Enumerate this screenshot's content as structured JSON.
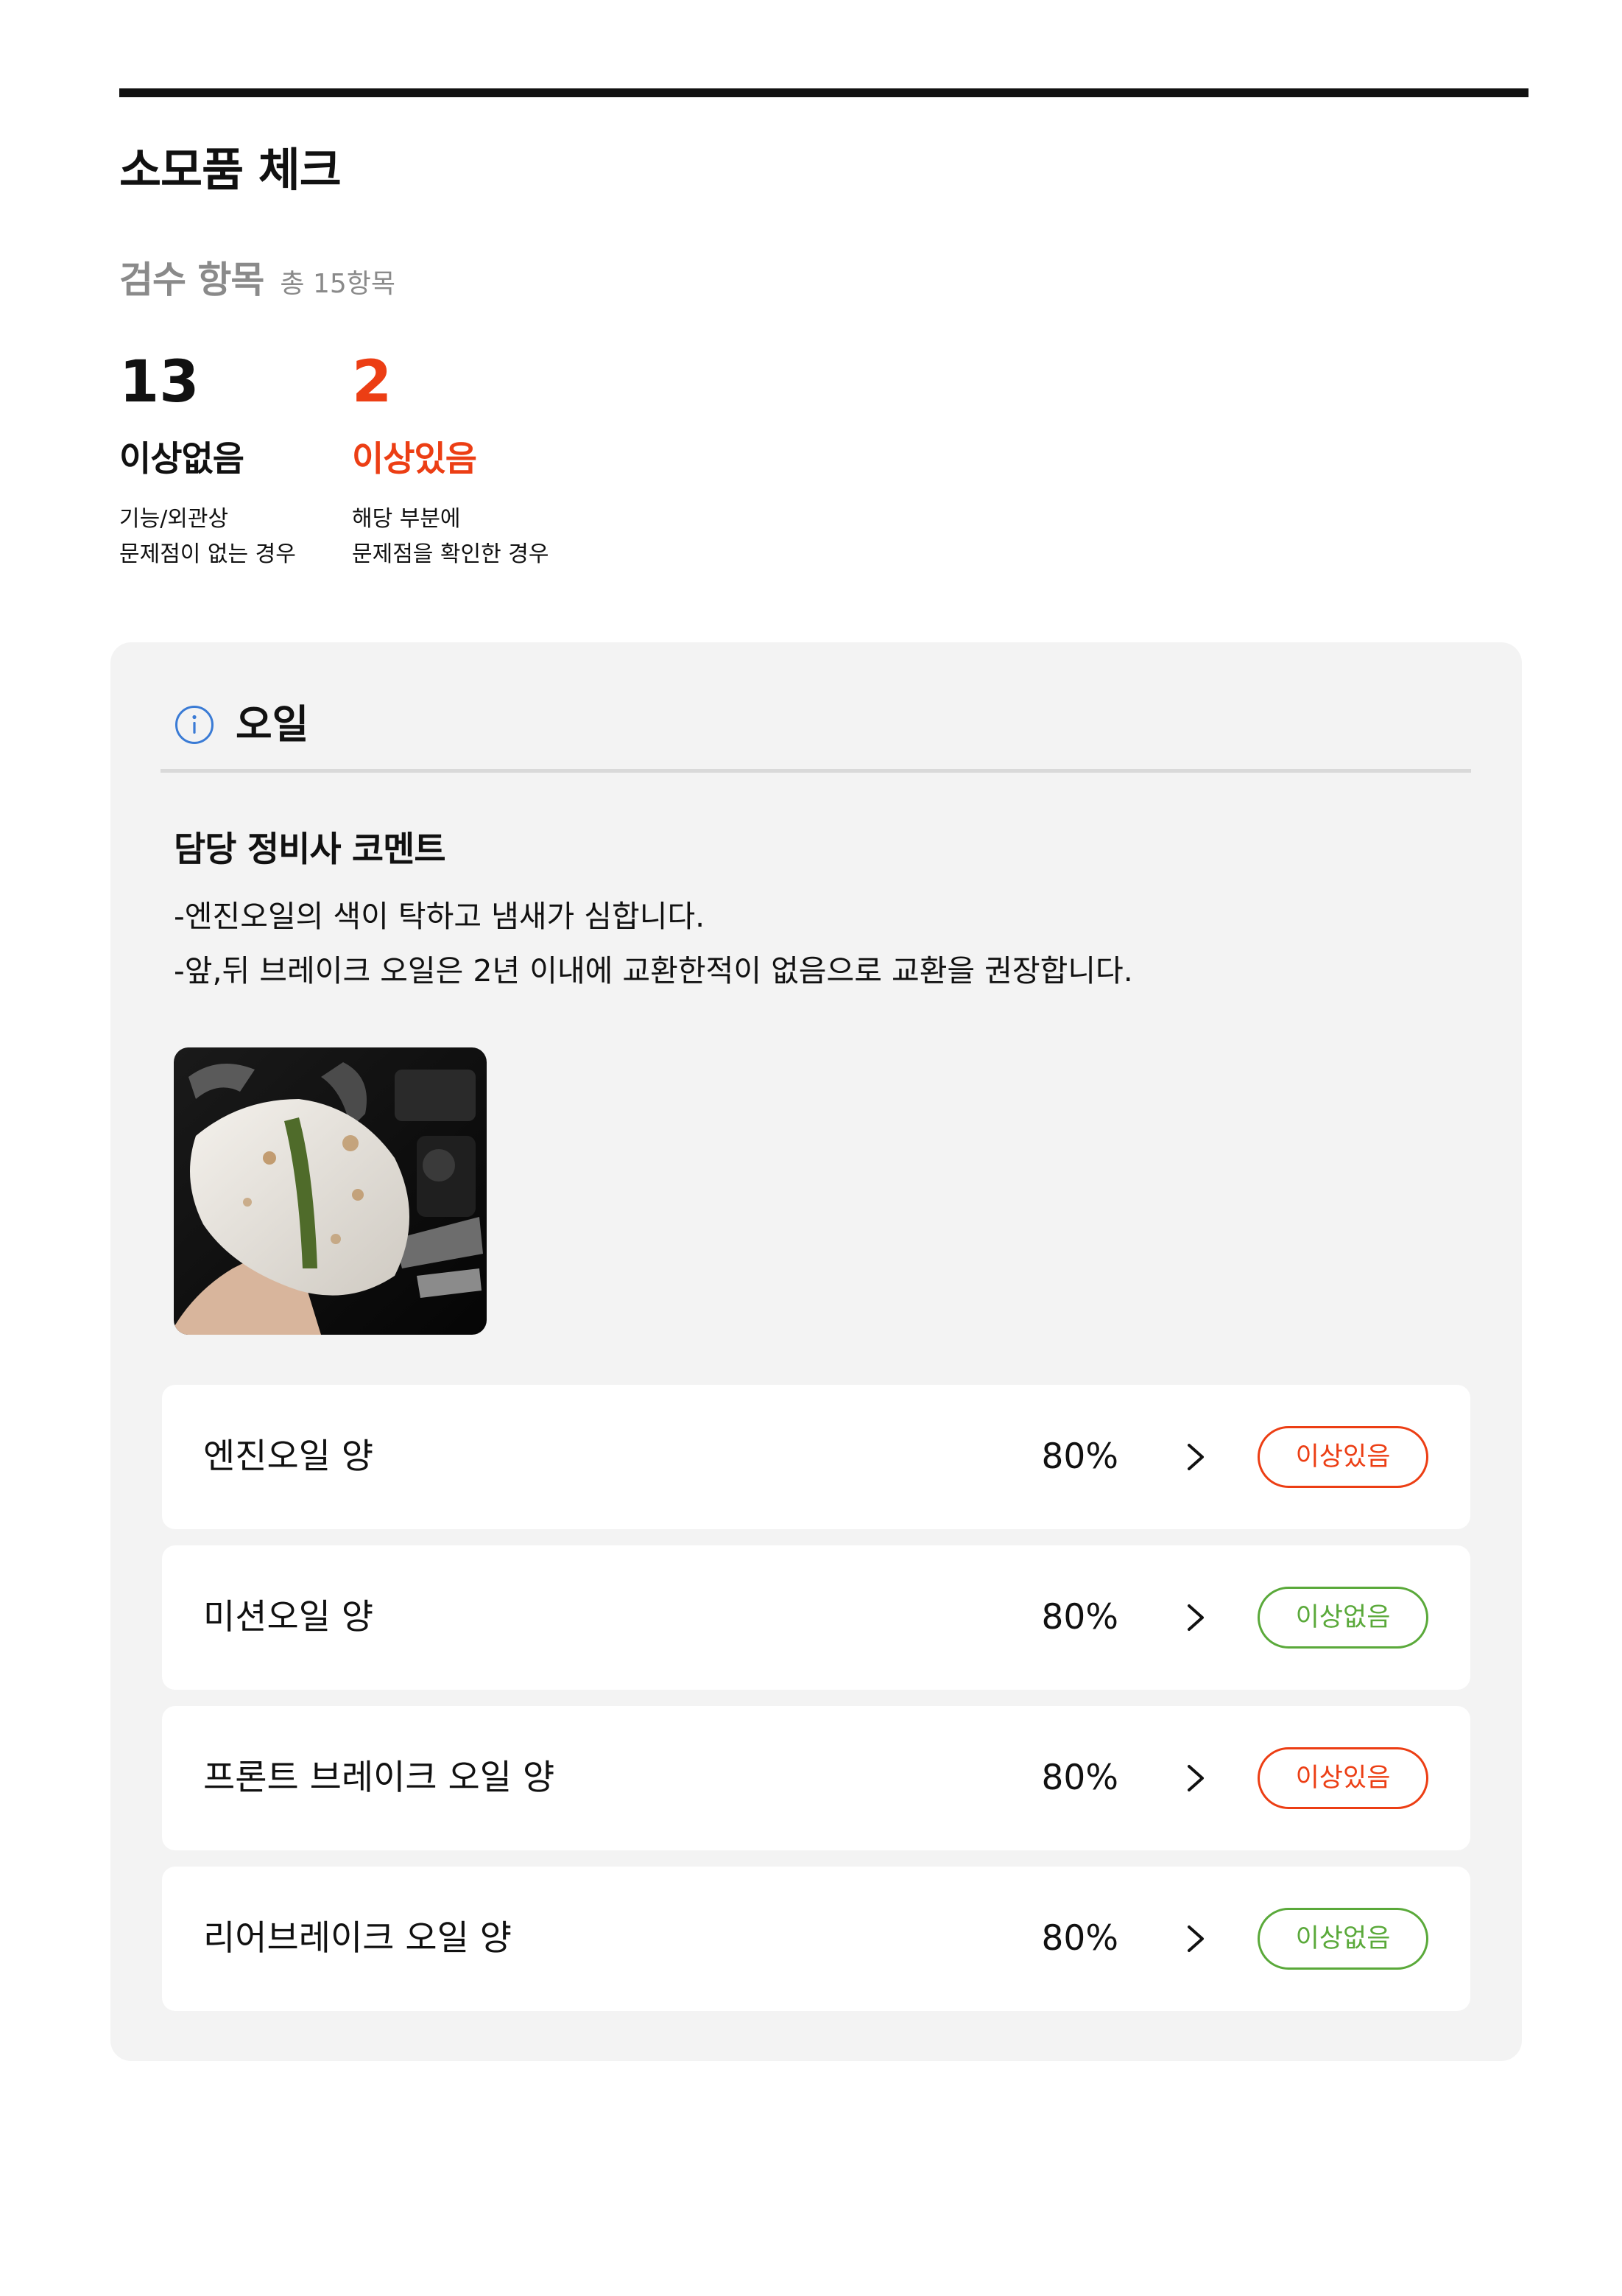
{
  "header": {
    "title": "소모품 체크"
  },
  "inspection": {
    "title": "검수 항목",
    "total": "총 15항목"
  },
  "summary": {
    "ok": {
      "count": "13",
      "label": "이상없음",
      "description": "기능/외관상\n문제점이 없는 경우"
    },
    "issue": {
      "count": "2",
      "label": "이상있음",
      "description": "해당 부분에\n문제점을 확인한 경우"
    }
  },
  "section": {
    "icon": "info-icon",
    "title": "오일",
    "comment_title": "담당 정비사 코멘트",
    "comment_lines": [
      "-엔진오일의 색이 탁하고 냄새가 심합니다.",
      "-앞,뒤 브레이크 오일은 2년 이내에 교환한적이 없음으로 교환을 권장합니다."
    ],
    "photo": "oil-check-rag-photo",
    "items": [
      {
        "name": "엔진오일 양",
        "value": "80%",
        "status": "이상있음",
        "status_color": "#ec3e14"
      },
      {
        "name": "미션오일 양",
        "value": "80%",
        "status": "이상없음",
        "status_color": "#5aa93a"
      },
      {
        "name": "프론트 브레이크 오일 양",
        "value": "80%",
        "status": "이상있음",
        "status_color": "#ec3e14"
      },
      {
        "name": "리어브레이크 오일 양",
        "value": "80%",
        "status": "이상없음",
        "status_color": "#5aa93a"
      }
    ]
  },
  "colors": {
    "issue": "#ec3e14",
    "ok": "#5aa93a",
    "panel_background": "#f3f3f3",
    "info_icon": "#3a7bd5"
  }
}
